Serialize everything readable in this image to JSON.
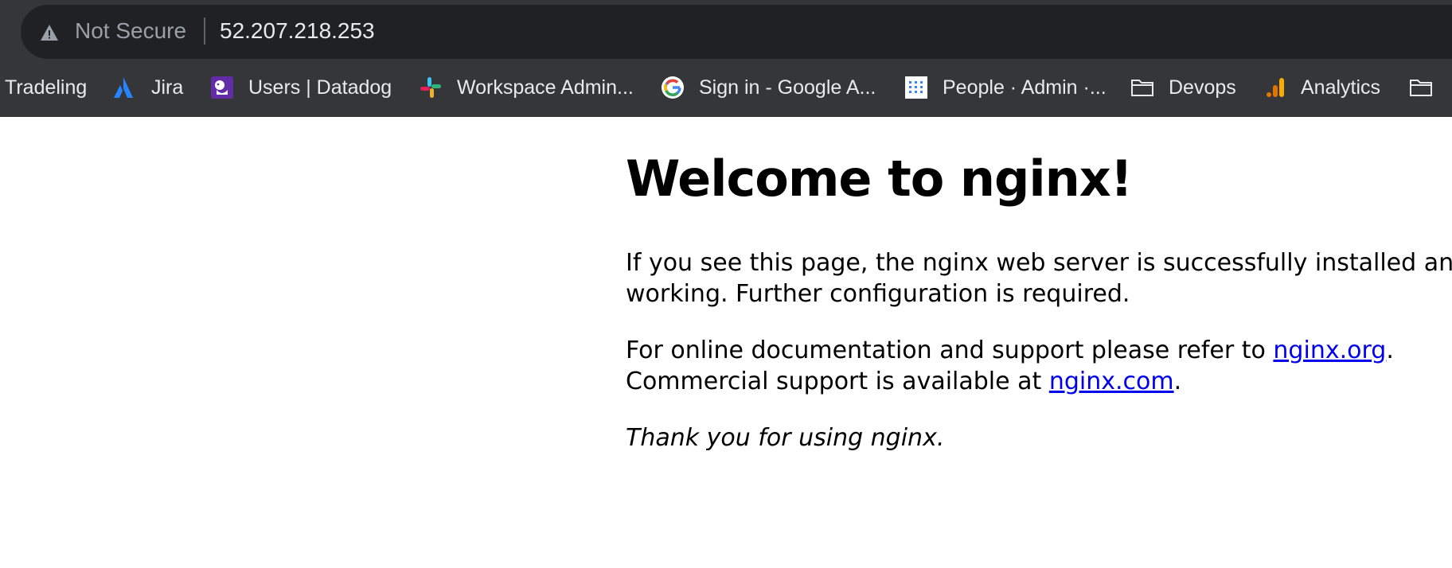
{
  "browser": {
    "security_label": "Not Secure",
    "url": "52.207.218.253",
    "bookmarks": [
      {
        "label": "Tradeling",
        "icon": "none"
      },
      {
        "label": "Jira",
        "icon": "jira-icon"
      },
      {
        "label": "Users | Datadog",
        "icon": "datadog-icon"
      },
      {
        "label": "Workspace Admin...",
        "icon": "slack-icon"
      },
      {
        "label": "Sign in - Google A...",
        "icon": "google-icon"
      },
      {
        "label": "People · Admin ·...",
        "icon": "admin-icon"
      },
      {
        "label": "Devops",
        "icon": "folder-icon"
      },
      {
        "label": "Analytics",
        "icon": "analytics-icon"
      },
      {
        "label": "",
        "icon": "folder-icon"
      }
    ]
  },
  "page": {
    "title": "Welcome to nginx!",
    "para1_line1": "If you see this page, the nginx web server is successfully installed and",
    "para1_line2": "working. Further configuration is required.",
    "para2_prefix": "For online documentation and support please refer to ",
    "para2_link": "nginx.org",
    "para2_suffix": ".",
    "para3_prefix": "Commercial support is available at ",
    "para3_link": "nginx.com",
    "para3_suffix": ".",
    "thanks": "Thank you for using nginx."
  },
  "colors": {
    "toolbar_bg": "#35363a",
    "omnibox_bg": "#202124",
    "link": "#0000ee"
  }
}
